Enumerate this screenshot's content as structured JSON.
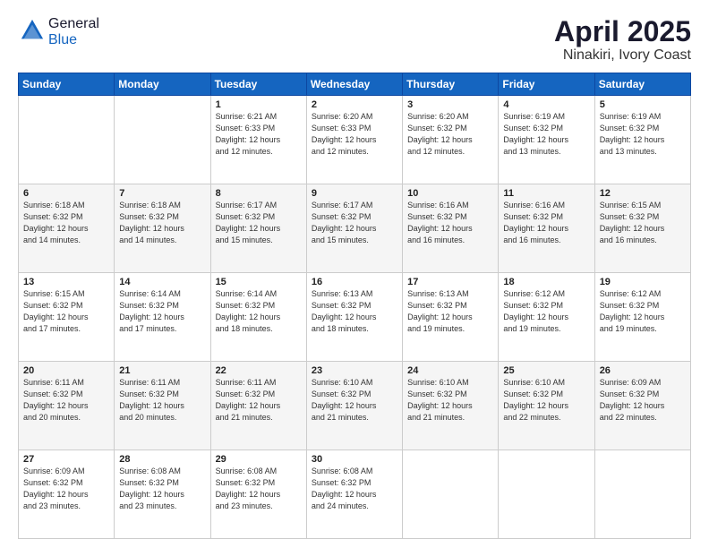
{
  "logo": {
    "general": "General",
    "blue": "Blue"
  },
  "title": "April 2025",
  "subtitle": "Ninakiri, Ivory Coast",
  "days_of_week": [
    "Sunday",
    "Monday",
    "Tuesday",
    "Wednesday",
    "Thursday",
    "Friday",
    "Saturday"
  ],
  "weeks": [
    [
      null,
      null,
      {
        "day": 1,
        "sunrise": "6:21 AM",
        "sunset": "6:33 PM",
        "daylight": "12 hours and 12 minutes."
      },
      {
        "day": 2,
        "sunrise": "6:20 AM",
        "sunset": "6:33 PM",
        "daylight": "12 hours and 12 minutes."
      },
      {
        "day": 3,
        "sunrise": "6:20 AM",
        "sunset": "6:32 PM",
        "daylight": "12 hours and 12 minutes."
      },
      {
        "day": 4,
        "sunrise": "6:19 AM",
        "sunset": "6:32 PM",
        "daylight": "12 hours and 13 minutes."
      },
      {
        "day": 5,
        "sunrise": "6:19 AM",
        "sunset": "6:32 PM",
        "daylight": "12 hours and 13 minutes."
      }
    ],
    [
      {
        "day": 6,
        "sunrise": "6:18 AM",
        "sunset": "6:32 PM",
        "daylight": "12 hours and 14 minutes."
      },
      {
        "day": 7,
        "sunrise": "6:18 AM",
        "sunset": "6:32 PM",
        "daylight": "12 hours and 14 minutes."
      },
      {
        "day": 8,
        "sunrise": "6:17 AM",
        "sunset": "6:32 PM",
        "daylight": "12 hours and 15 minutes."
      },
      {
        "day": 9,
        "sunrise": "6:17 AM",
        "sunset": "6:32 PM",
        "daylight": "12 hours and 15 minutes."
      },
      {
        "day": 10,
        "sunrise": "6:16 AM",
        "sunset": "6:32 PM",
        "daylight": "12 hours and 16 minutes."
      },
      {
        "day": 11,
        "sunrise": "6:16 AM",
        "sunset": "6:32 PM",
        "daylight": "12 hours and 16 minutes."
      },
      {
        "day": 12,
        "sunrise": "6:15 AM",
        "sunset": "6:32 PM",
        "daylight": "12 hours and 16 minutes."
      }
    ],
    [
      {
        "day": 13,
        "sunrise": "6:15 AM",
        "sunset": "6:32 PM",
        "daylight": "12 hours and 17 minutes."
      },
      {
        "day": 14,
        "sunrise": "6:14 AM",
        "sunset": "6:32 PM",
        "daylight": "12 hours and 17 minutes."
      },
      {
        "day": 15,
        "sunrise": "6:14 AM",
        "sunset": "6:32 PM",
        "daylight": "12 hours and 18 minutes."
      },
      {
        "day": 16,
        "sunrise": "6:13 AM",
        "sunset": "6:32 PM",
        "daylight": "12 hours and 18 minutes."
      },
      {
        "day": 17,
        "sunrise": "6:13 AM",
        "sunset": "6:32 PM",
        "daylight": "12 hours and 19 minutes."
      },
      {
        "day": 18,
        "sunrise": "6:12 AM",
        "sunset": "6:32 PM",
        "daylight": "12 hours and 19 minutes."
      },
      {
        "day": 19,
        "sunrise": "6:12 AM",
        "sunset": "6:32 PM",
        "daylight": "12 hours and 19 minutes."
      }
    ],
    [
      {
        "day": 20,
        "sunrise": "6:11 AM",
        "sunset": "6:32 PM",
        "daylight": "12 hours and 20 minutes."
      },
      {
        "day": 21,
        "sunrise": "6:11 AM",
        "sunset": "6:32 PM",
        "daylight": "12 hours and 20 minutes."
      },
      {
        "day": 22,
        "sunrise": "6:11 AM",
        "sunset": "6:32 PM",
        "daylight": "12 hours and 21 minutes."
      },
      {
        "day": 23,
        "sunrise": "6:10 AM",
        "sunset": "6:32 PM",
        "daylight": "12 hours and 21 minutes."
      },
      {
        "day": 24,
        "sunrise": "6:10 AM",
        "sunset": "6:32 PM",
        "daylight": "12 hours and 21 minutes."
      },
      {
        "day": 25,
        "sunrise": "6:10 AM",
        "sunset": "6:32 PM",
        "daylight": "12 hours and 22 minutes."
      },
      {
        "day": 26,
        "sunrise": "6:09 AM",
        "sunset": "6:32 PM",
        "daylight": "12 hours and 22 minutes."
      }
    ],
    [
      {
        "day": 27,
        "sunrise": "6:09 AM",
        "sunset": "6:32 PM",
        "daylight": "12 hours and 23 minutes."
      },
      {
        "day": 28,
        "sunrise": "6:08 AM",
        "sunset": "6:32 PM",
        "daylight": "12 hours and 23 minutes."
      },
      {
        "day": 29,
        "sunrise": "6:08 AM",
        "sunset": "6:32 PM",
        "daylight": "12 hours and 23 minutes."
      },
      {
        "day": 30,
        "sunrise": "6:08 AM",
        "sunset": "6:32 PM",
        "daylight": "12 hours and 24 minutes."
      },
      null,
      null,
      null
    ]
  ],
  "labels": {
    "sunrise": "Sunrise:",
    "sunset": "Sunset:",
    "daylight": "Daylight:"
  }
}
